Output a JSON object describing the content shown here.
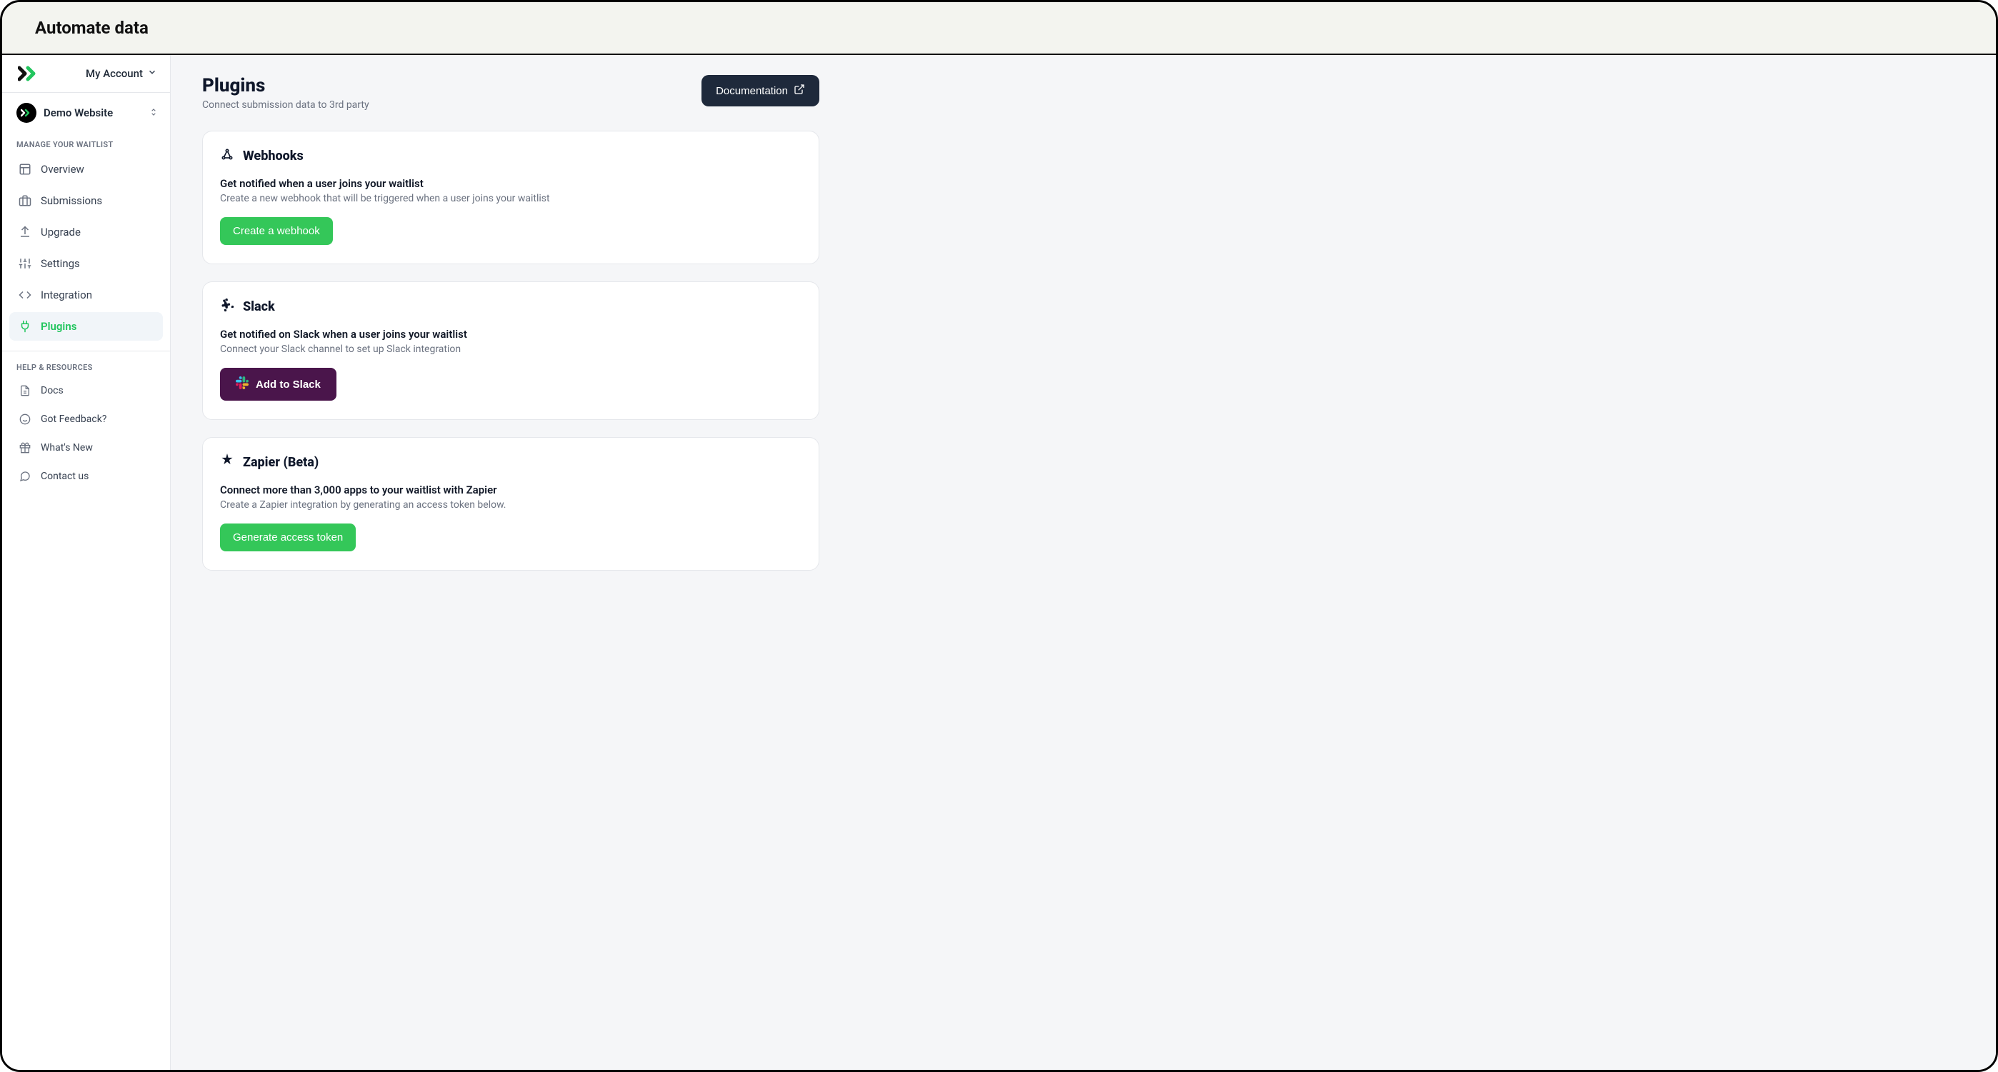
{
  "topbar": {
    "title": "Automate data"
  },
  "sidebar": {
    "account_label": "My Account",
    "site_name": "Demo Website",
    "section1_label": "MANAGE YOUR WAITLIST",
    "nav": {
      "overview": "Overview",
      "submissions": "Submissions",
      "upgrade": "Upgrade",
      "settings": "Settings",
      "integration": "Integration",
      "plugins": "Plugins"
    },
    "section2_label": "HELP & RESOURCES",
    "help": {
      "docs": "Docs",
      "feedback": "Got Feedback?",
      "whatsnew": "What's New",
      "contact": "Contact us"
    }
  },
  "page": {
    "title": "Plugins",
    "subtitle": "Connect submission data to 3rd party",
    "doc_button": "Documentation"
  },
  "cards": {
    "webhooks": {
      "title": "Webhooks",
      "sub1": "Get notified when a user joins your waitlist",
      "sub2": "Create a new webhook that will be triggered when a user joins your waitlist",
      "button": "Create a webhook"
    },
    "slack": {
      "title": "Slack",
      "sub1": "Get notified on Slack when a user joins your waitlist",
      "sub2": "Connect your Slack channel to set up Slack integration",
      "button": "Add to Slack"
    },
    "zapier": {
      "title": "Zapier (Beta)",
      "sub1": "Connect more than 3,000 apps to your waitlist with Zapier",
      "sub2": "Create a Zapier integration by generating an access token below.",
      "button": "Generate access token"
    }
  }
}
